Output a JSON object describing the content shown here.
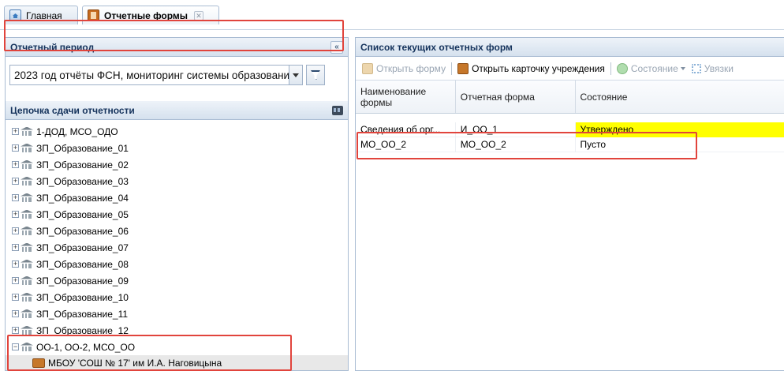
{
  "tabs": {
    "home_label": "Главная",
    "forms_label": "Отчетные формы",
    "forms_close": "✕"
  },
  "left_panel": {
    "period_title": "Отчетный период",
    "collapse_glyph": "«",
    "period_value": "2023 год отчёты ФСН, мониторинг системы образовани",
    "chain_title": "Цепочка сдачи отчетности",
    "tree": [
      {
        "label": "1-ДОД, МСО_ОДО",
        "expander": "+"
      },
      {
        "label": "ЗП_Образование_01",
        "expander": "+"
      },
      {
        "label": "ЗП_Образование_02",
        "expander": "+"
      },
      {
        "label": "ЗП_Образование_03",
        "expander": "+"
      },
      {
        "label": "ЗП_Образование_04",
        "expander": "+"
      },
      {
        "label": "ЗП_Образование_05",
        "expander": "+"
      },
      {
        "label": "ЗП_Образование_06",
        "expander": "+"
      },
      {
        "label": "ЗП_Образование_07",
        "expander": "+"
      },
      {
        "label": "ЗП_Образование_08",
        "expander": "+"
      },
      {
        "label": "ЗП_Образование_09",
        "expander": "+"
      },
      {
        "label": "ЗП_Образование_10",
        "expander": "+"
      },
      {
        "label": "ЗП_Образование_11",
        "expander": "+"
      },
      {
        "label": "ЗП_Образование_12",
        "expander": "+"
      },
      {
        "label": "ОО-1, ОО-2, МСО_ОО",
        "expander": "−"
      }
    ],
    "child": {
      "label": "МБОУ 'СОШ № 17' им И.А. Наговицына"
    }
  },
  "right_panel": {
    "title": "Список текущих отчетных форм",
    "toolbar": {
      "open_form": "Открыть форму",
      "open_card": "Открыть карточку учреждения",
      "state": "Состояние",
      "links": "Увязки"
    },
    "columns": [
      "Наименование формы",
      "Отчетная форма",
      "Состояние"
    ],
    "rows": [
      {
        "name": "Сведения об орг...",
        "form": "И_ОО_1",
        "state": "Утверждено"
      },
      {
        "name": "МО_ОО_2",
        "form": "МО_ОО_2",
        "state": "Пусто"
      }
    ]
  },
  "colors": {
    "highlight": "#e1443c",
    "approved_bg": "#ffff00"
  },
  "icons": [
    "home-icon",
    "forms-icon",
    "close-icon",
    "collapse-icon",
    "dropdown-arrow-icon",
    "filter-icon",
    "binoculars-icon",
    "expander-icon",
    "institution-icon",
    "briefcase-icon",
    "open-form-icon",
    "open-card-icon",
    "state-icon",
    "links-icon"
  ]
}
